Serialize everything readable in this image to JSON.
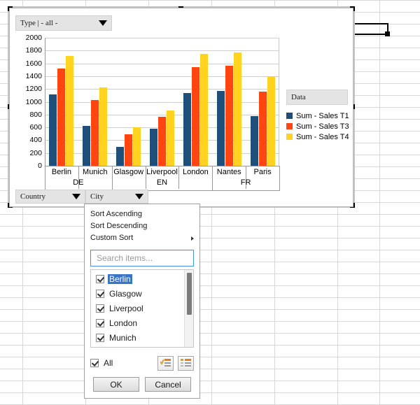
{
  "spreadsheet": {
    "cell_cursor": "selected-cell"
  },
  "chart_object": {
    "type_filter": {
      "label": "Type | - all -",
      "caret": "chevron-down-icon"
    },
    "country_filter": {
      "label": "Country",
      "caret": "chevron-down-icon"
    },
    "city_filter": {
      "label": "City",
      "caret": "chevron-down-icon"
    },
    "legend_header": "Data"
  },
  "chart_data": {
    "type": "bar",
    "title": "",
    "xlabel": "",
    "ylabel": "",
    "ylim": [
      0,
      2000
    ],
    "yticks": [
      0,
      200,
      400,
      600,
      800,
      1000,
      1200,
      1400,
      1600,
      1800,
      2000
    ],
    "grid": true,
    "legend_position": "right",
    "categories": [
      "Berlin",
      "Munich",
      "Glasgow",
      "Liverpool",
      "London",
      "Nantes",
      "Paris"
    ],
    "groups": [
      {
        "label": "DE",
        "categories": [
          "Berlin",
          "Munich"
        ]
      },
      {
        "label": "EN",
        "categories": [
          "Glasgow",
          "Liverpool",
          "London"
        ]
      },
      {
        "label": "FR",
        "categories": [
          "Nantes",
          "Paris"
        ]
      }
    ],
    "series": [
      {
        "name": "Sum - Sales T1",
        "color": "#1F4E79",
        "values": [
          1115,
          620,
          300,
          580,
          1140,
          1165,
          775
        ]
      },
      {
        "name": "Sum - Sales T3",
        "color": "#FF4510",
        "values": [
          1520,
          1025,
          495,
          760,
          1545,
          1565,
          1155
        ]
      },
      {
        "name": "Sum - Sales T4",
        "color": "#FFD320",
        "values": [
          1720,
          1225,
          600,
          860,
          1750,
          1775,
          1385
        ]
      }
    ]
  },
  "dropdown": {
    "menu_items": [
      {
        "label": "Sort Ascending",
        "submenu": false
      },
      {
        "label": "Sort Descending",
        "submenu": false
      },
      {
        "label": "Custom Sort",
        "submenu": true
      }
    ],
    "search": {
      "value": "",
      "placeholder": "Search items..."
    },
    "items": [
      {
        "label": "Berlin",
        "checked": true,
        "selected": true
      },
      {
        "label": "Glasgow",
        "checked": true,
        "selected": false
      },
      {
        "label": "Liverpool",
        "checked": true,
        "selected": false
      },
      {
        "label": "London",
        "checked": true,
        "selected": false
      },
      {
        "label": "Munich",
        "checked": true,
        "selected": false
      }
    ],
    "all": {
      "label": "All",
      "checked": true
    },
    "icon_buttons": [
      {
        "name": "show-only-current-icon"
      },
      {
        "name": "hide-only-current-icon"
      }
    ],
    "ok_label": "OK",
    "cancel_label": "Cancel"
  }
}
